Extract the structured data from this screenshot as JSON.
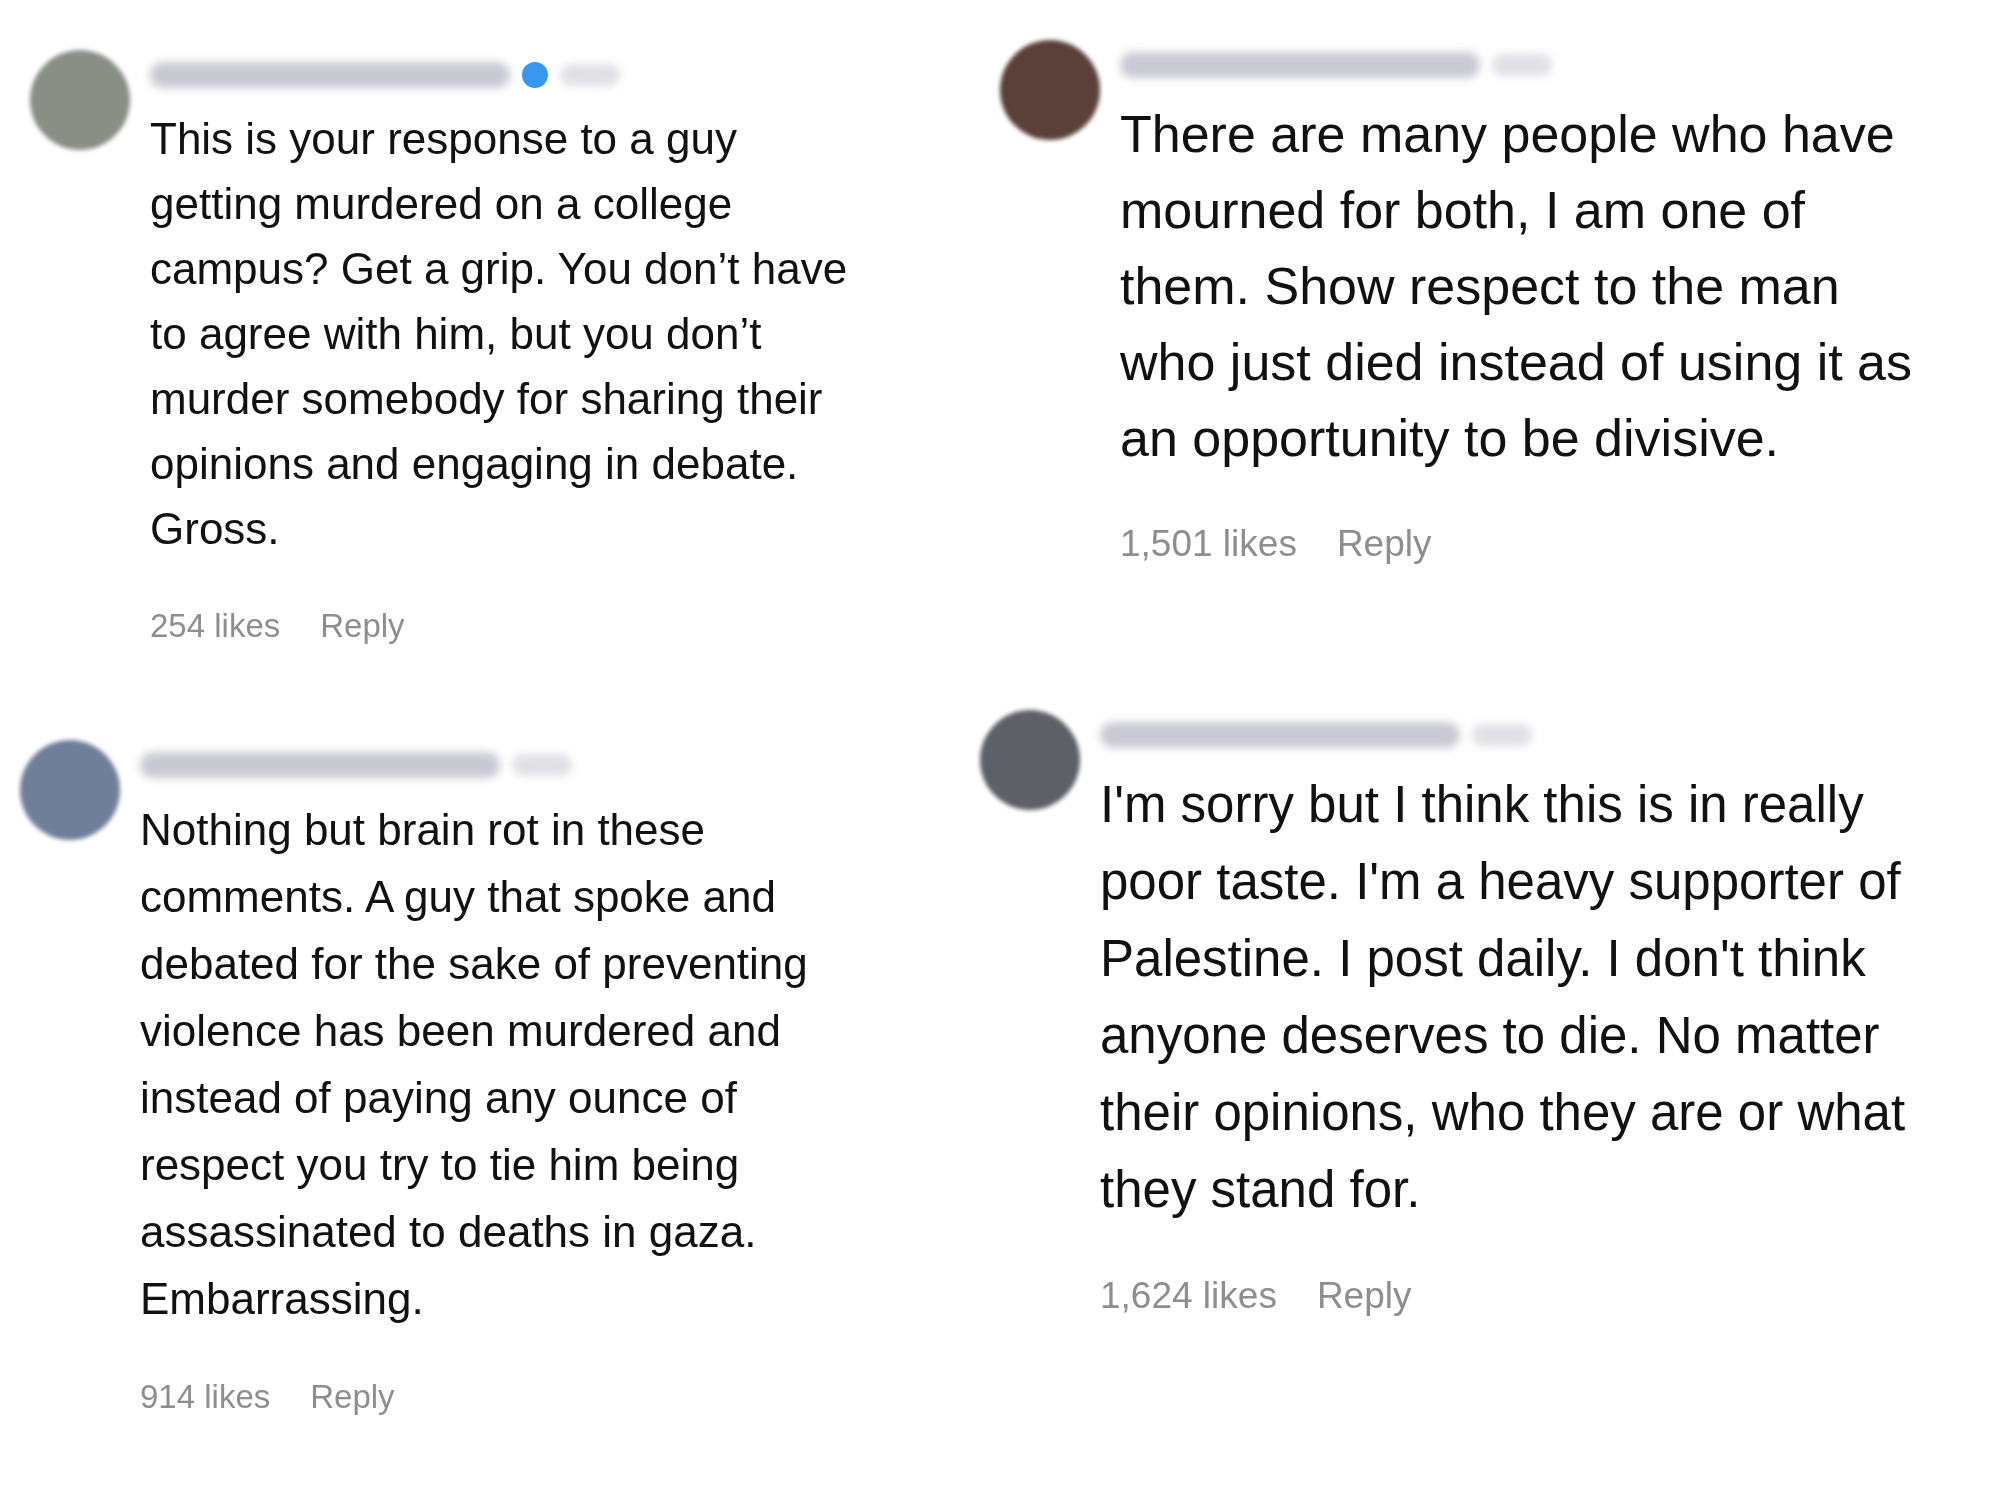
{
  "comments": [
    {
      "verified": true,
      "text": "This is your response to a guy getting murdered on a college campus? Get a grip. You don’t have to agree with him, but you don’t murder somebody for sharing their opinions and engaging in debate. Gross.",
      "likes": "254 likes",
      "reply": "Reply"
    },
    {
      "verified": false,
      "text": "Nothing but brain rot in these comments. A guy that spoke and debated for the sake of preventing violence has been murdered and instead of paying any ounce of respect you try to tie him being assassinated to deaths in gaza. Embarrassing.",
      "likes": "914 likes",
      "reply": "Reply"
    },
    {
      "verified": false,
      "text": "There are many people who have mourned for both, I am one of them. Show respect to the man who just died instead of using it as an opportunity to be divisive.",
      "likes": "1,501 likes",
      "reply": "Reply"
    },
    {
      "verified": false,
      "text": "I'm sorry but I think this is in really poor taste. I'm a heavy supporter of Palestine. I post daily. I don't think anyone deserves to die. No matter their opinions, who they are or what they stand for.",
      "likes": "1,624 likes",
      "reply": "Reply"
    }
  ]
}
